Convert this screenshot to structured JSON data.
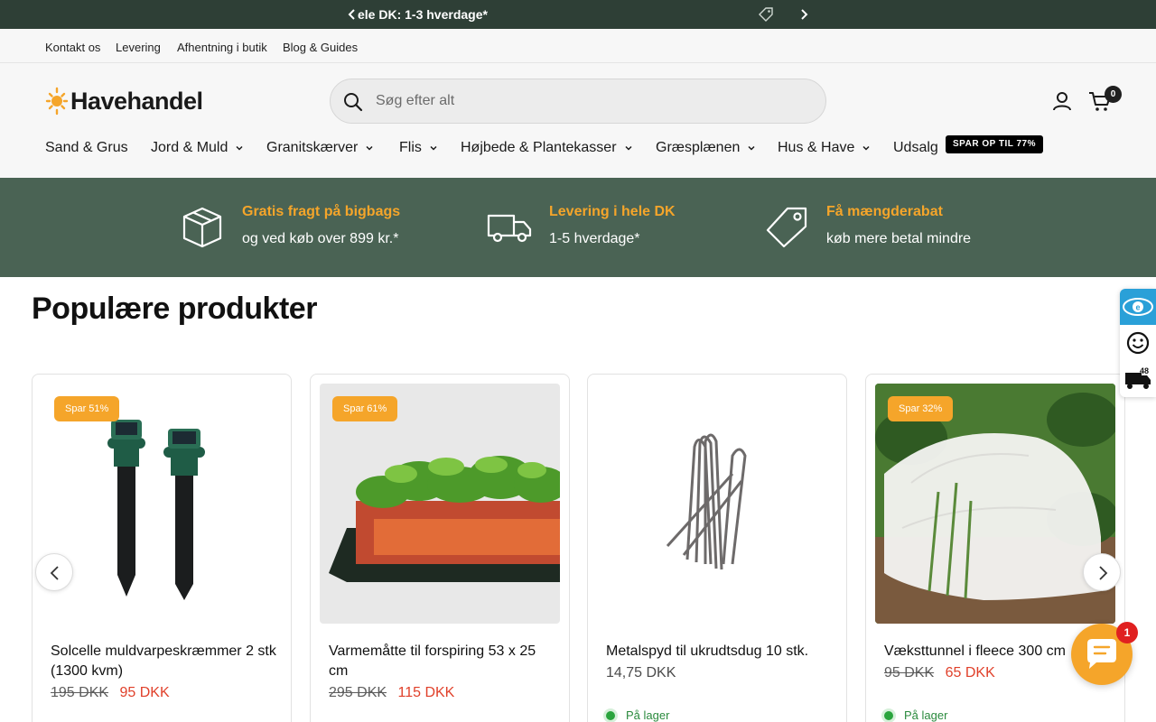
{
  "announcement": {
    "text": "ele DK: 1-3 hverdage*"
  },
  "subnav": {
    "links": [
      "Kontakt os",
      "Levering",
      "Afhentning i butik",
      "Blog & Guides"
    ]
  },
  "header": {
    "logo": "Havehandel",
    "search_placeholder": "Søg efter alt",
    "cart_count": "0"
  },
  "mainnav": {
    "items": [
      "Sand & Grus",
      "Jord & Muld",
      "Granitskærver",
      "Flis",
      "Højbede & Plantekasser",
      "Græsplænen",
      "Hus & Have",
      "Udsalg"
    ],
    "sale_badge": "SPAR OP TIL 77%"
  },
  "usp": [
    {
      "title": "Gratis fragt på bigbags",
      "subtitle": "og ved køb over 899 kr.*",
      "icon": "box-icon"
    },
    {
      "title": "Levering i hele DK",
      "subtitle": "1-5 hverdage*",
      "icon": "truck-icon"
    },
    {
      "title": "Få mængderabat",
      "subtitle": "køb mere betal mindre",
      "icon": "price-tag-icon"
    }
  ],
  "section": {
    "title": "Populære produkter"
  },
  "products": [
    {
      "badge": "Spar 51%",
      "name": "Solcelle muldvarpeskræmmer 2 stk (1300 kvm)",
      "old_price": "195 DKK",
      "price": "95 DKK",
      "stock": ""
    },
    {
      "badge": "Spar 61%",
      "name": "Varmemåtte til forspiring 53 x 25 cm",
      "old_price": "295 DKK",
      "price": "115 DKK",
      "stock": ""
    },
    {
      "badge": "",
      "name": "Metalspyd til ukrudtsdug 10 stk.",
      "old_price": "",
      "price": "14,75 DKK",
      "stock": "På lager"
    },
    {
      "badge": "Spar 32%",
      "name": "Væksttunnel i fleece 300 cm",
      "old_price": "95 DKK",
      "price": "65 DKK",
      "stock": "På lager"
    }
  ],
  "side_widget": {
    "badge": "48"
  },
  "chat": {
    "unread": "1"
  },
  "colors": {
    "dark_green": "#2e3f36",
    "usp_green": "#4a6354",
    "accent_orange": "#f5a52a",
    "sale_red": "#e0402a"
  }
}
